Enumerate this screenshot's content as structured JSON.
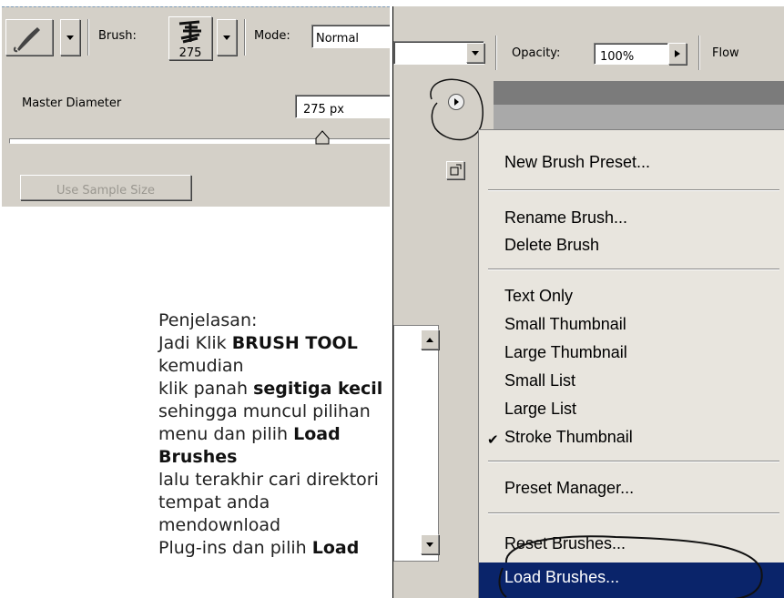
{
  "toolbar": {
    "brush_label": "Brush:",
    "brush_size": "275",
    "mode_label": "Mode:",
    "mode_value": "Normal",
    "opacity_label": "Opacity:",
    "opacity_value": "100%",
    "flow_label": "Flow"
  },
  "brush_panel": {
    "master_diameter_label": "Master Diameter",
    "diameter_value": "275 px",
    "diameter_fraction": 0.82,
    "use_sample_size": "Use Sample Size"
  },
  "menu": {
    "items": [
      {
        "label": "New Brush Preset..."
      },
      {
        "label": "Rename Brush..."
      },
      {
        "label": "Delete Brush"
      },
      {
        "label": "Text Only"
      },
      {
        "label": "Small Thumbnail"
      },
      {
        "label": "Large Thumbnail"
      },
      {
        "label": "Small List"
      },
      {
        "label": "Large List"
      },
      {
        "label": "Stroke Thumbnail",
        "checked": true
      },
      {
        "label": "Preset Manager..."
      },
      {
        "label": "Reset Brushes..."
      },
      {
        "label": "Load Brushes...",
        "highlighted": true
      }
    ]
  },
  "explanation": {
    "heading": "Penjelasan:",
    "p1": "Jadi Klik ",
    "b1": "BRUSH TOOL",
    "p2": " kemudian",
    "p3": "klik panah ",
    "b2": "segitiga kecil",
    "p4": "sehingga muncul pilihan",
    "p5": "menu dan pilih ",
    "b3": "Load Brushes",
    "p6": "lalu terakhir cari direktori",
    "p7": "tempat anda mendownload",
    "p8": "Plug-ins dan pilih ",
    "b4": "Load"
  },
  "colors": {
    "panel_bg": "#d4d0c8",
    "highlight": "#0a246a"
  }
}
